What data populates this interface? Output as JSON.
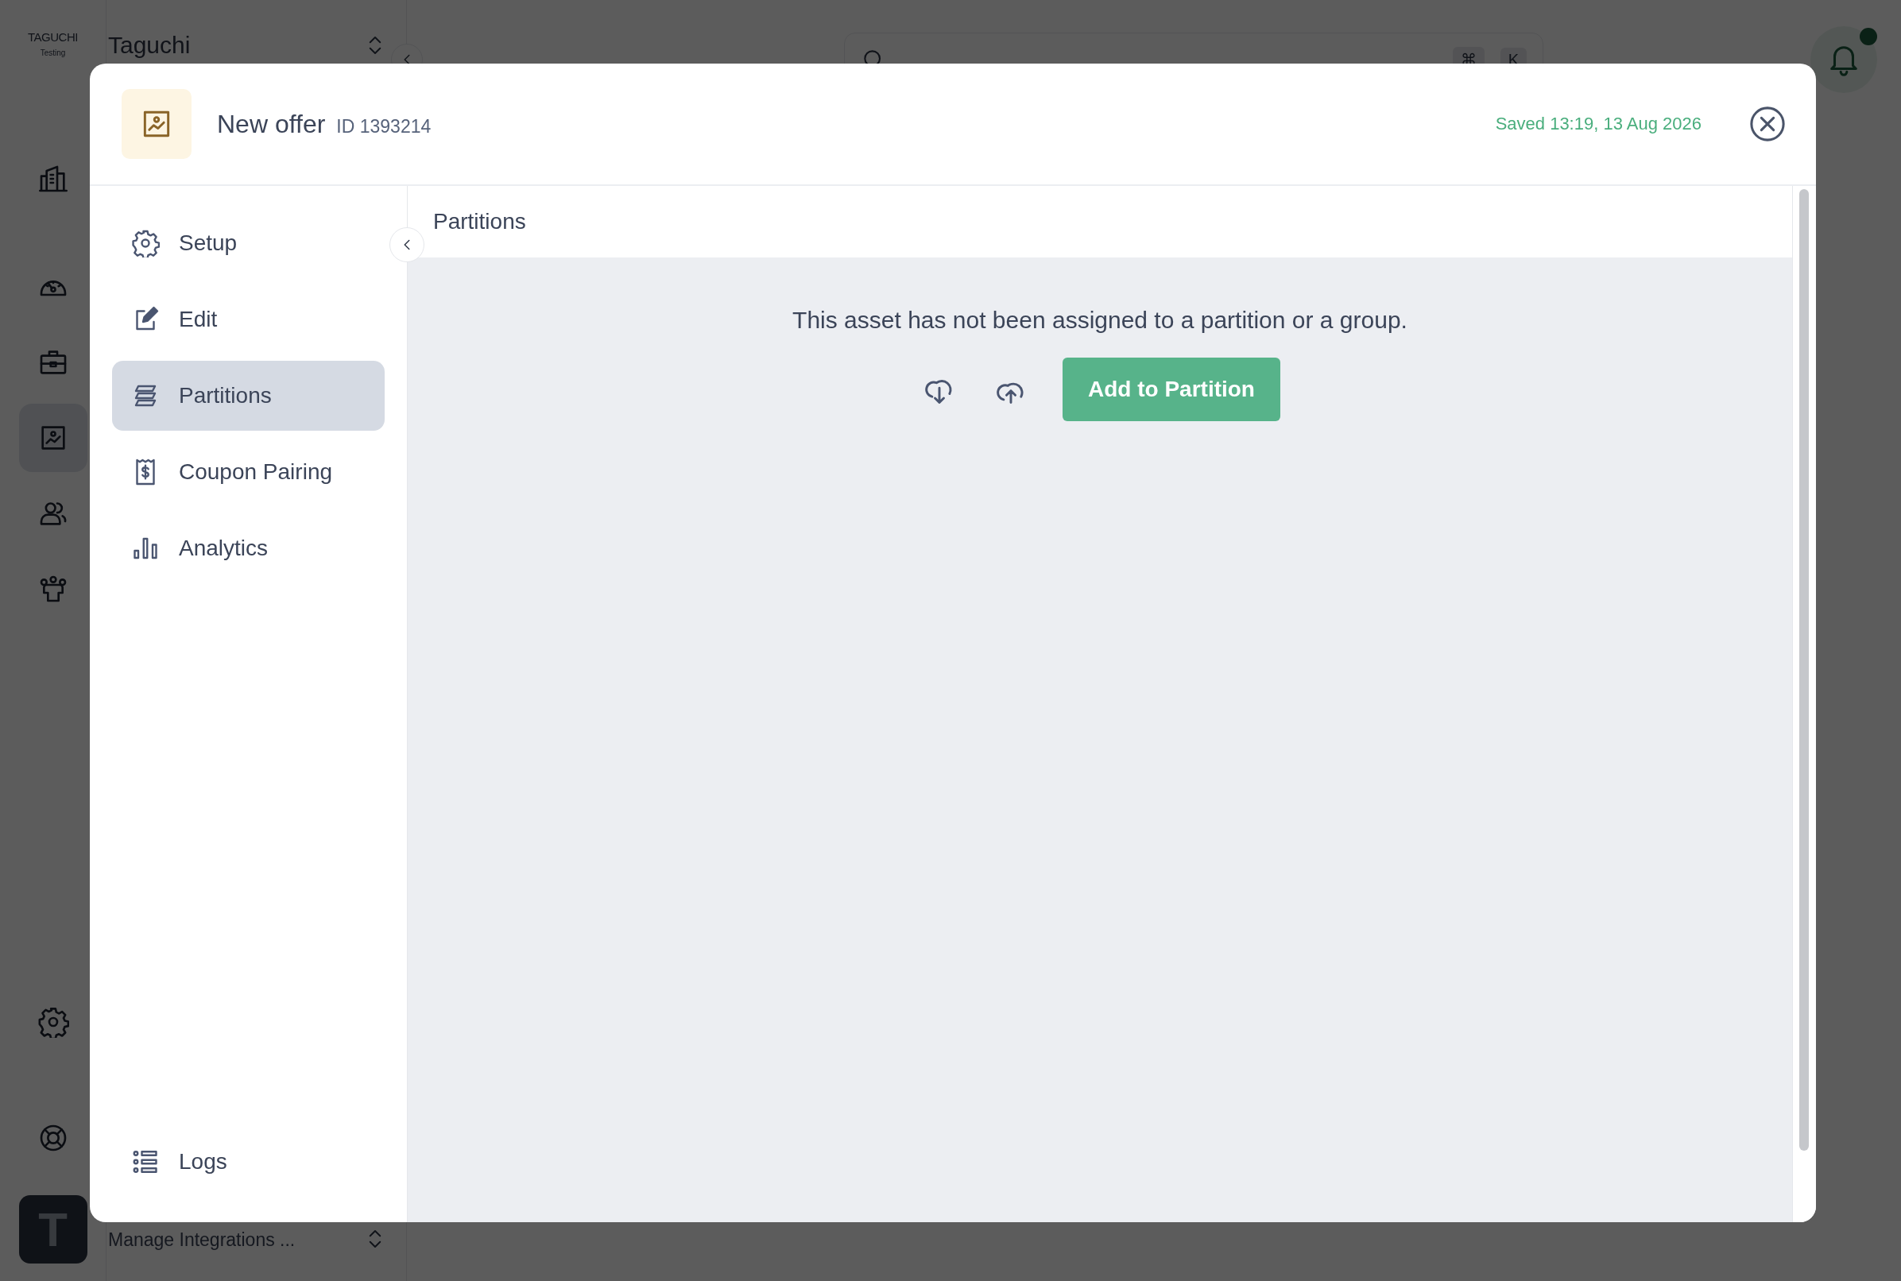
{
  "background": {
    "brand": {
      "logo_text": "TAGUCHI",
      "subtitle": "Testing"
    },
    "workspace": {
      "name": "Taguchi"
    },
    "rail_items": [
      {
        "kind": "building",
        "selected": false
      },
      {
        "kind": "gauge",
        "selected": false
      },
      {
        "kind": "briefcase",
        "selected": false
      },
      {
        "kind": "image",
        "selected": true
      },
      {
        "kind": "users",
        "selected": false
      },
      {
        "kind": "team",
        "selected": false
      }
    ],
    "rail_bottom": [
      {
        "kind": "gear"
      },
      {
        "kind": "lifebuoy"
      }
    ],
    "search": {
      "shortcut": [
        "⌘",
        "K"
      ]
    },
    "notifications": {
      "unread": true
    },
    "user": {
      "initial": "T",
      "subtitle": "Manage Integrations ..."
    }
  },
  "modal": {
    "title": "New offer",
    "id": "ID 1393214",
    "saved": "Saved 13:19, 13 Aug 2026",
    "nav": [
      {
        "kind": "gear",
        "label": "Setup",
        "selected": false
      },
      {
        "kind": "edit",
        "label": "Edit",
        "selected": false
      },
      {
        "kind": "partitions",
        "label": "Partitions",
        "selected": true
      },
      {
        "kind": "coupon",
        "label": "Coupon Pairing",
        "selected": false
      },
      {
        "kind": "analytics",
        "label": "Analytics",
        "selected": false
      }
    ],
    "footer_nav": [
      {
        "kind": "logs",
        "label": "Logs",
        "selected": false
      }
    ],
    "section_title": "Partitions",
    "empty_message": "This asset has not been assigned to a partition or a group.",
    "action_button": "Add to Partition"
  }
}
